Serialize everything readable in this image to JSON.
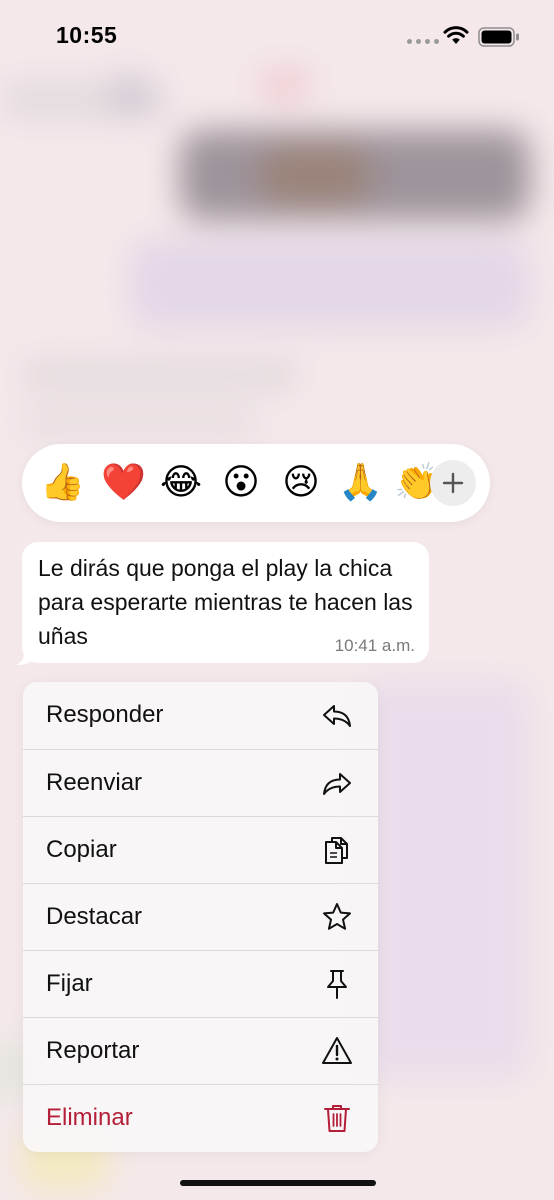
{
  "status_bar": {
    "time": "10:55"
  },
  "reactions": {
    "emojis": [
      {
        "name": "thumbs-up-emoji",
        "char": "👍"
      },
      {
        "name": "red-heart-emoji",
        "char": "❤️"
      },
      {
        "name": "tears-of-joy-emoji",
        "char": "😂"
      },
      {
        "name": "astonished-face-emoji",
        "char": "😮"
      },
      {
        "name": "crying-face-emoji",
        "char": "😢"
      },
      {
        "name": "folded-hands-emoji",
        "char": "🙏"
      },
      {
        "name": "clapping-hands-emoji",
        "char": "👏"
      }
    ],
    "more_icon": "plus-icon"
  },
  "message": {
    "text": "Le dirás que ponga el play la chica para esperarte mientras te hacen las uñas",
    "time": "10:41 a.m."
  },
  "menu": {
    "items": [
      {
        "label": "Responder",
        "icon": "reply-icon"
      },
      {
        "label": "Reenviar",
        "icon": "forward-icon"
      },
      {
        "label": "Copiar",
        "icon": "copy-icon"
      },
      {
        "label": "Destacar",
        "icon": "star-icon"
      },
      {
        "label": "Fijar",
        "icon": "pin-icon"
      },
      {
        "label": "Reportar",
        "icon": "warning-icon"
      },
      {
        "label": "Eliminar",
        "icon": "trash-icon",
        "destructive": true
      }
    ]
  },
  "colors": {
    "destructive": "#b51e38",
    "background": "#f3e7e9",
    "bubble": "#ffffff"
  }
}
